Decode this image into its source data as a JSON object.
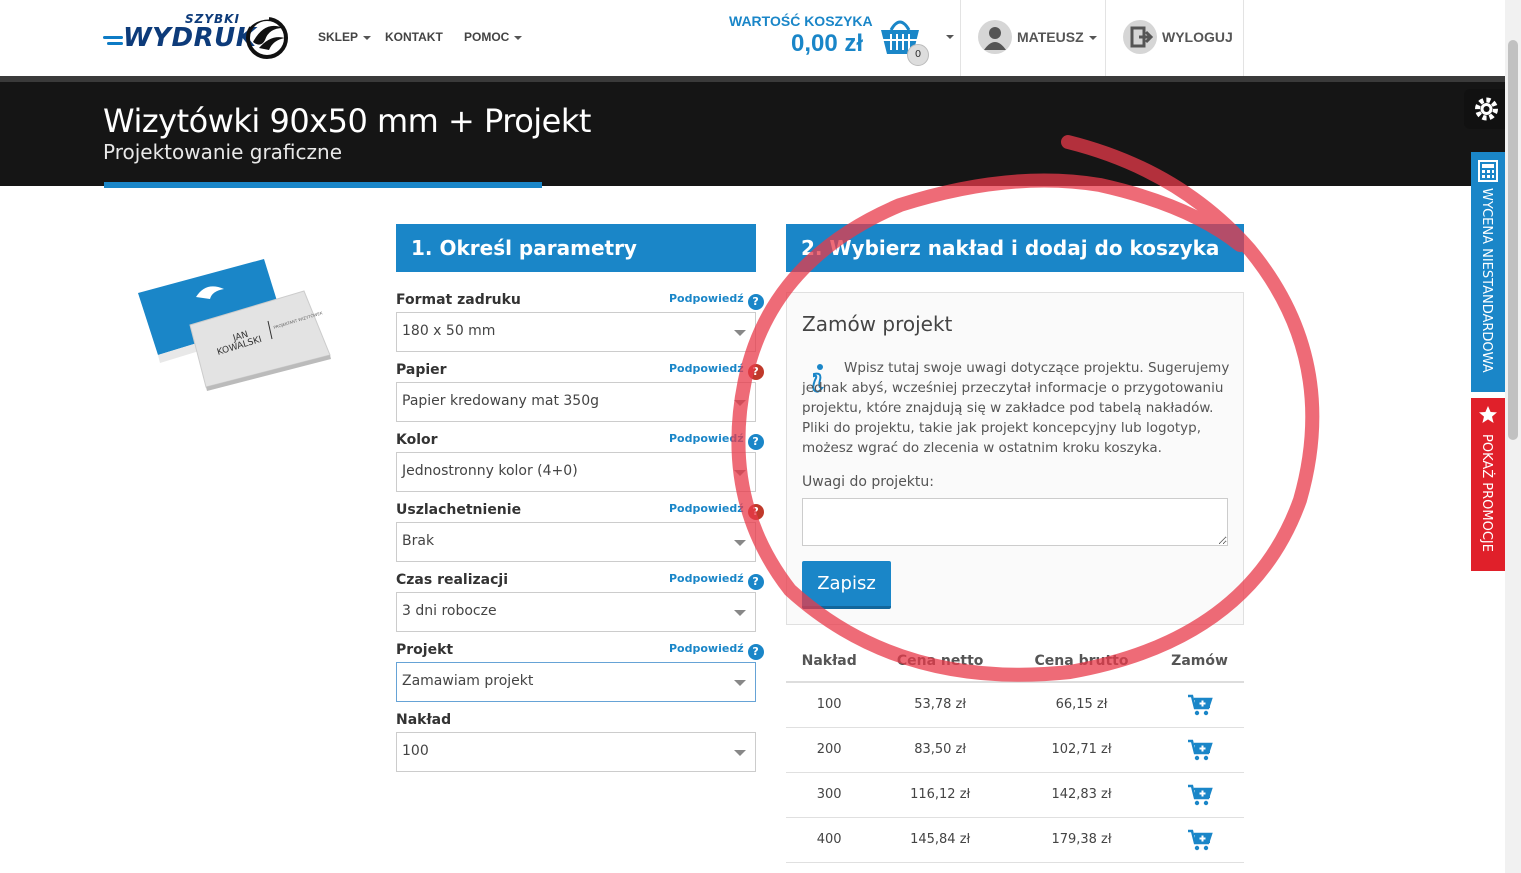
{
  "header": {
    "logo_top": "SZYBKI",
    "logo_main": "WYDRUK",
    "nav": [
      "SKLEP",
      "KONTAKT",
      "POMOC"
    ],
    "cart_label": "WARTOŚĆ KOSZYKA",
    "cart_value": "0,00 zł",
    "cart_count": "0",
    "user_name": "MATEUSZ",
    "logout": "WYLOGUJ"
  },
  "banner": {
    "title": "Wizytówki 90x50 mm + Projekt",
    "subtitle": "Projektowanie graficzne"
  },
  "product_card": {
    "name_line1": "JAN",
    "name_line2": "KOWALSKI",
    "tagline": "PROJEKTANT WIZYTÓWEK"
  },
  "params": {
    "heading": "1. Określ parametry",
    "hint_label": "Podpowiedź",
    "hint_icon": "?",
    "fields": [
      {
        "label": "Format zadruku",
        "value": "180 x 50 mm"
      },
      {
        "label": "Papier",
        "value": "Papier kredowany mat 350g"
      },
      {
        "label": "Kolor",
        "value": "Jednostronny kolor (4+0)"
      },
      {
        "label": "Uszlachetnienie",
        "value": "Brak"
      },
      {
        "label": "Czas realizacji",
        "value": "3 dni robocze"
      },
      {
        "label": "Projekt",
        "value": "Zamawiam projekt"
      },
      {
        "label": "Nakład",
        "value": "100"
      }
    ]
  },
  "order": {
    "heading": "2. Wybierz nakład i dodaj do koszyka",
    "project_title": "Zamów projekt",
    "info_text": "Wpisz tutaj swoje uwagi dotyczące projektu. Sugerujemy jednak abyś, wcześniej przeczytał informacje o przygotowaniu projektu, które znajdują się w zakładce pod tabelą nakładów. Pliki do projektu, takie jak projekt koncepcyjny lub logotyp, możesz wgrać do zlecenia w ostatnim kroku koszyka.",
    "notes_label": "Uwagi do projektu:",
    "notes_value": "",
    "save_label": "Zapisz"
  },
  "price_table": {
    "headers": [
      "Nakład",
      "Cena netto",
      "Cena brutto",
      "Zamów"
    ],
    "rows": [
      [
        "100",
        "53,78 zł",
        "66,15 zł"
      ],
      [
        "200",
        "83,50 zł",
        "102,71 zł"
      ],
      [
        "300",
        "116,12 zł",
        "142,83 zł"
      ],
      [
        "400",
        "145,84 zł",
        "179,38 zł"
      ]
    ]
  },
  "side": {
    "custom_quote": "WYCENA NIESTANDARDOWA",
    "promotions": "POKAŻ PROMOCJE"
  },
  "colors": {
    "accent": "#1a86c8",
    "banner": "#151515",
    "promo": "#e0202a",
    "circle": "#e8394a"
  },
  "icons": [
    "cart-icon",
    "user-icon",
    "logout-icon",
    "gear-icon",
    "calculator-icon",
    "star-icon",
    "info-icon",
    "add-to-cart-icon",
    "chevron-down-icon"
  ]
}
